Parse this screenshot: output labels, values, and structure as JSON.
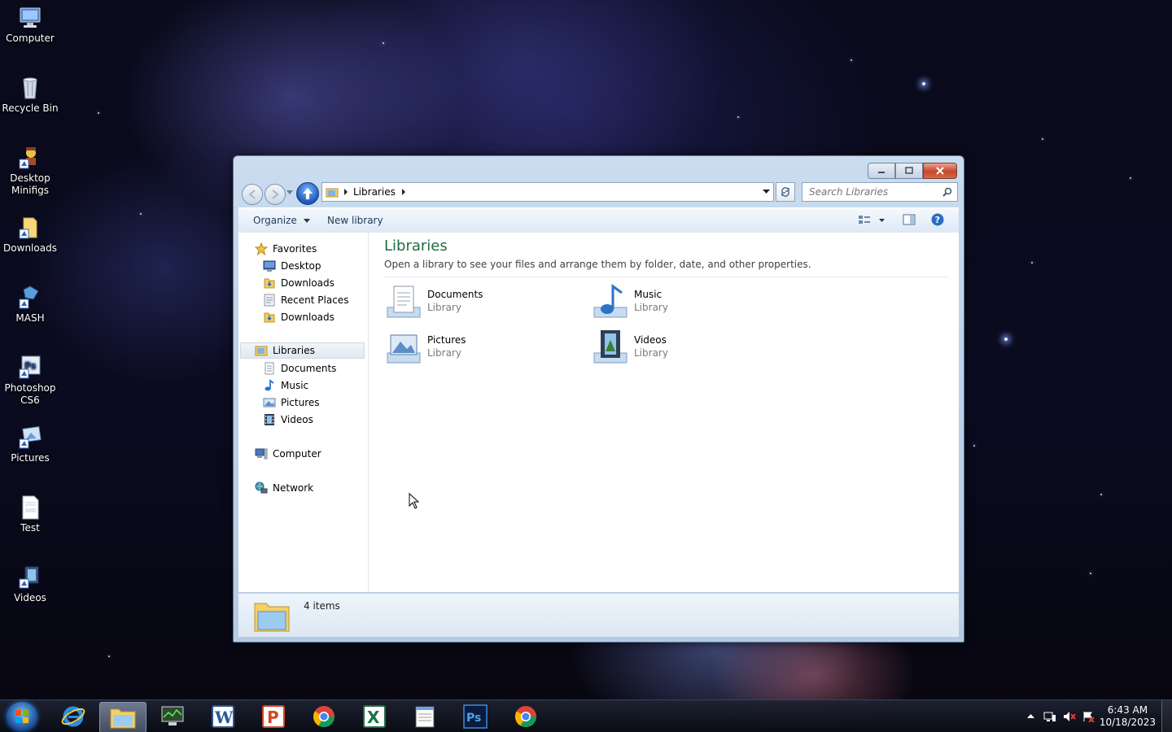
{
  "desktop": {
    "icons": [
      {
        "label": "Computer"
      },
      {
        "label": "Recycle Bin"
      },
      {
        "label": "Desktop Minifigs"
      },
      {
        "label": "Downloads"
      },
      {
        "label": "MASH"
      },
      {
        "label": "Photoshop CS6"
      },
      {
        "label": "Pictures"
      },
      {
        "label": "Test"
      },
      {
        "label": "Videos"
      }
    ]
  },
  "explorer": {
    "address": {
      "crumb": "Libraries"
    },
    "search": {
      "placeholder": "Search Libraries"
    },
    "toolbar": {
      "organize": "Organize",
      "new_library": "New library"
    },
    "nav": {
      "favorites": {
        "label": "Favorites",
        "items": [
          "Desktop",
          "Downloads",
          "Recent Places",
          "Downloads"
        ]
      },
      "libraries": {
        "label": "Libraries",
        "items": [
          "Documents",
          "Music",
          "Pictures",
          "Videos"
        ]
      },
      "computer": "Computer",
      "network": "Network"
    },
    "main": {
      "title": "Libraries",
      "description": "Open a library to see your files and arrange them by folder, date, and other properties.",
      "items": [
        {
          "name": "Documents",
          "type": "Library"
        },
        {
          "name": "Music",
          "type": "Library"
        },
        {
          "name": "Pictures",
          "type": "Library"
        },
        {
          "name": "Videos",
          "type": "Library"
        }
      ]
    },
    "status": {
      "count": "4 items"
    }
  },
  "taskbar": {
    "clock": {
      "time": "6:43 AM",
      "date": "10/18/2023"
    }
  }
}
